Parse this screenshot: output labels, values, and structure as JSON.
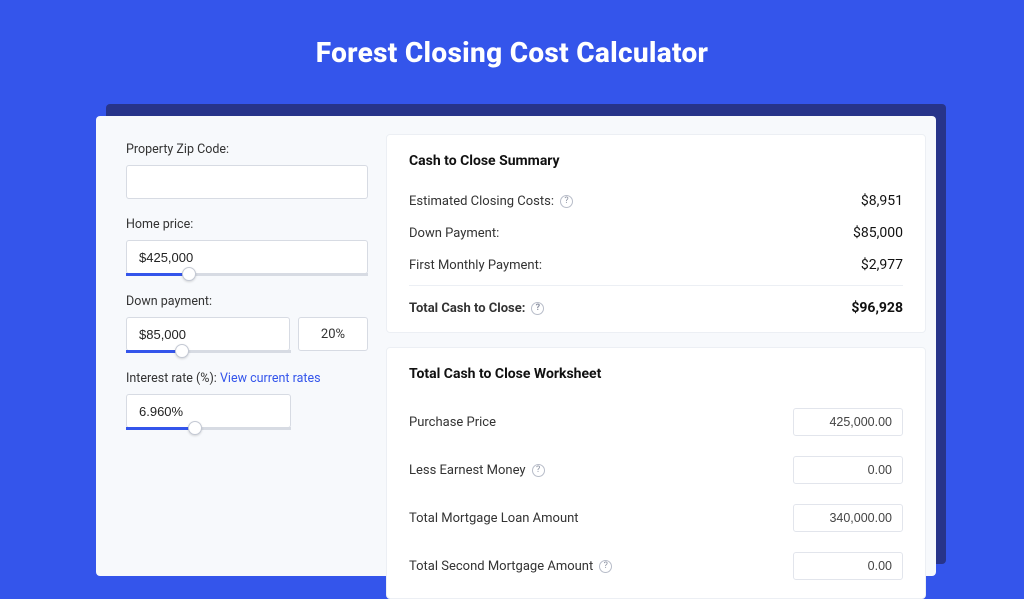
{
  "title": "Forest Closing Cost Calculator",
  "form": {
    "zip": {
      "label": "Property Zip Code:",
      "value": ""
    },
    "home_price": {
      "label": "Home price:",
      "value": "$425,000",
      "slider_pct": 26
    },
    "down_payment": {
      "label": "Down payment:",
      "value": "$85,000",
      "pct": "20%",
      "slider_pct": 34
    },
    "interest_rate": {
      "label": "Interest rate (%):",
      "link": "View current rates",
      "value": "6.960%",
      "slider_pct": 42
    }
  },
  "summary": {
    "heading": "Cash to Close Summary",
    "rows": [
      {
        "label": "Estimated Closing Costs:",
        "help": true,
        "value": "$8,951"
      },
      {
        "label": "Down Payment:",
        "help": false,
        "value": "$85,000"
      },
      {
        "label": "First Monthly Payment:",
        "help": false,
        "value": "$2,977"
      }
    ],
    "total": {
      "label": "Total Cash to Close:",
      "help": true,
      "value": "$96,928"
    }
  },
  "worksheet": {
    "heading": "Total Cash to Close Worksheet",
    "rows": [
      {
        "label": "Purchase Price",
        "help": false,
        "value": "425,000.00"
      },
      {
        "label": "Less Earnest Money",
        "help": true,
        "value": "0.00"
      },
      {
        "label": "Total Mortgage Loan Amount",
        "help": false,
        "value": "340,000.00"
      },
      {
        "label": "Total Second Mortgage Amount",
        "help": true,
        "value": "0.00"
      }
    ]
  }
}
